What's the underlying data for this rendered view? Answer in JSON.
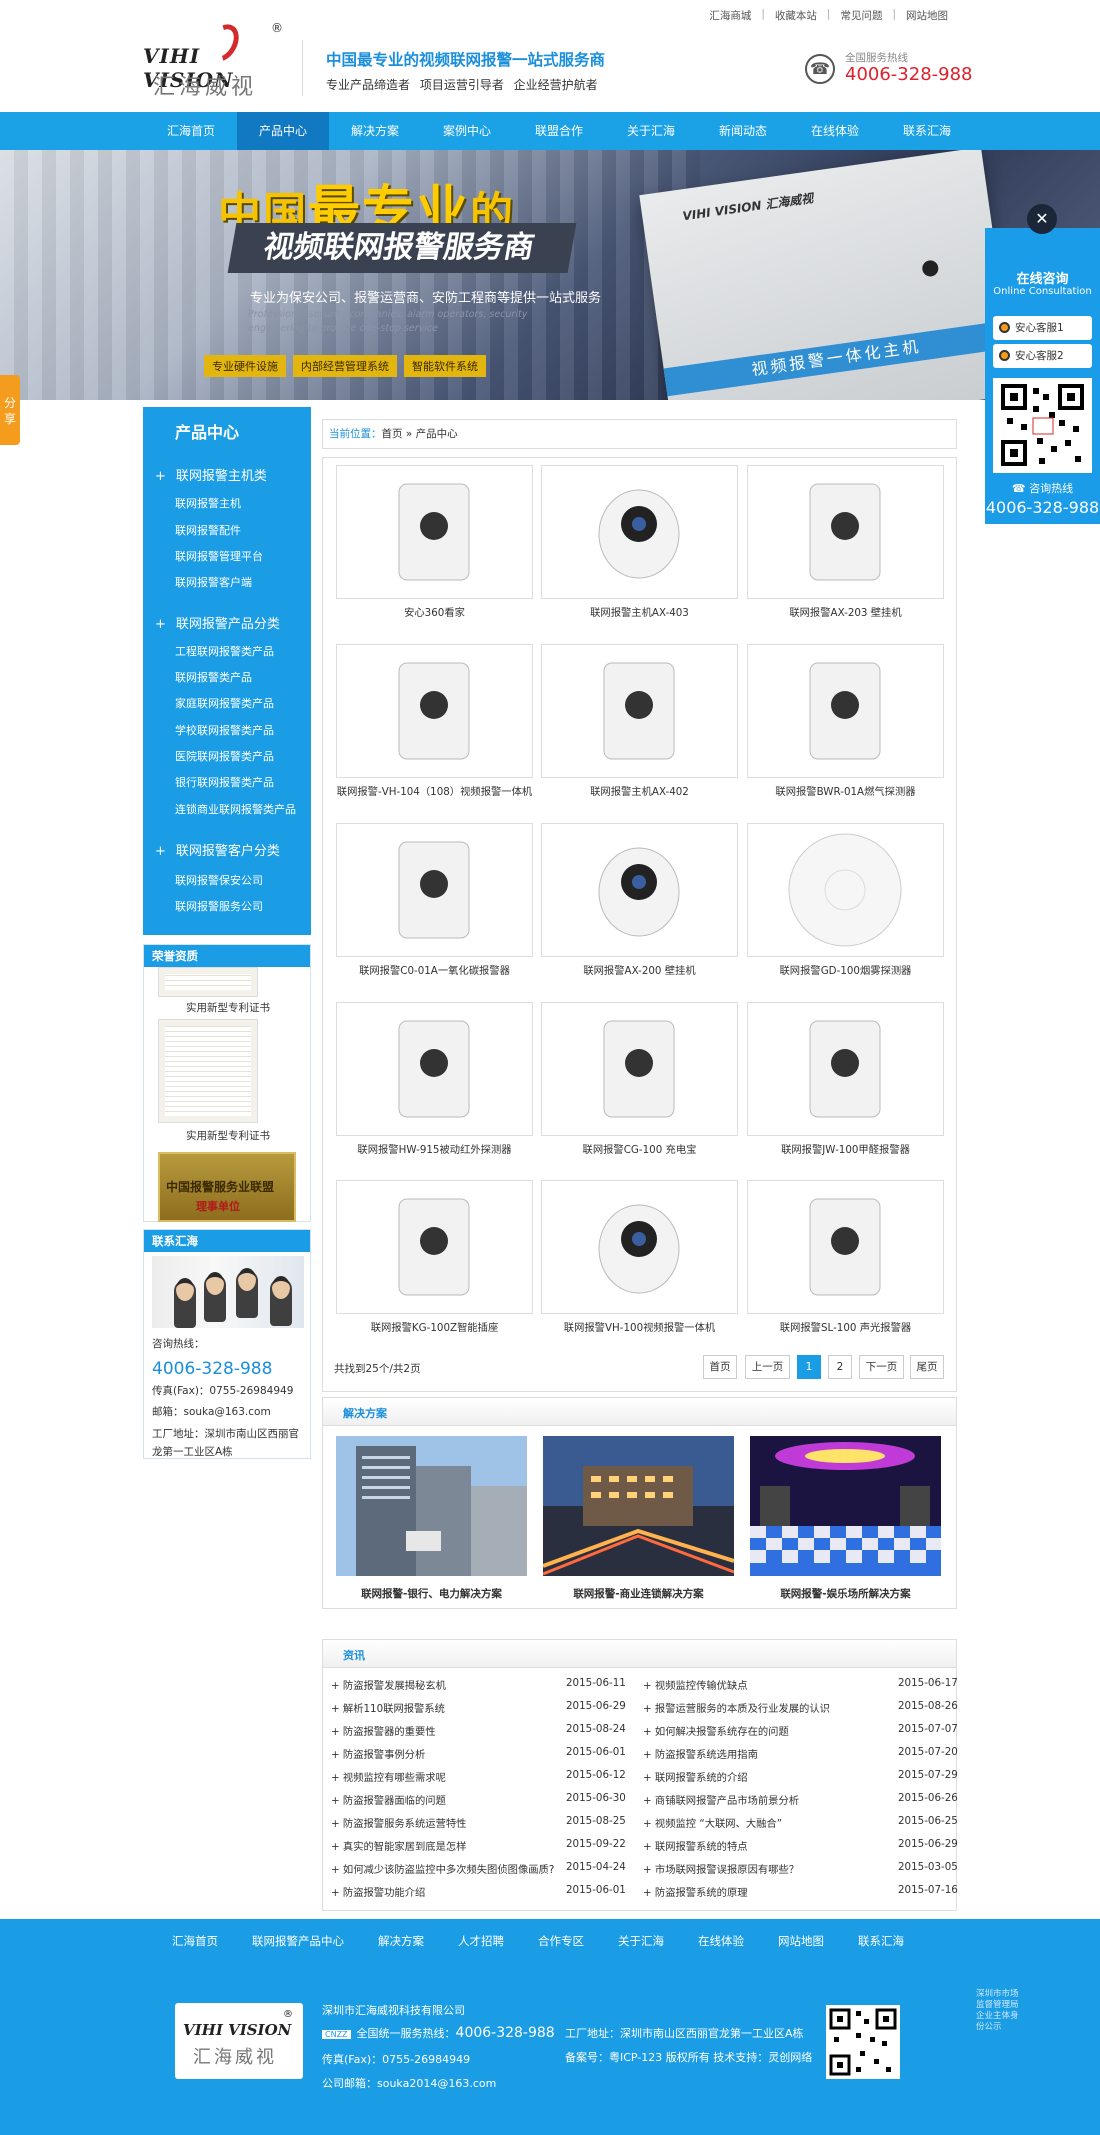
{
  "top_links": [
    "汇海商城",
    "收藏本站",
    "常见问题",
    "网站地图"
  ],
  "logo": {
    "en": "VIHI VISION",
    "cn": "汇海威视",
    "reg": "®"
  },
  "header": {
    "slogan": "中国最专业的视频联网报警一站式服务商",
    "subslogan": "专业产品缔造者 项目运营引导者 企业经营护航者",
    "hotline_label": "全国服务热线",
    "hotline": "4006-328-988"
  },
  "nav": [
    "汇海首页",
    "产品中心",
    "解决方案",
    "案例中心",
    "联盟合作",
    "关于汇海",
    "新闻动态",
    "在线体验",
    "联系汇海"
  ],
  "nav_active": 1,
  "banner": {
    "title1_a": "中国",
    "title1_b": "最专业",
    "title1_c": "的",
    "title2": "视频联网报警服务商",
    "desc": "专业为保安公司、报警运营商、安防工程商等提供一站式服务",
    "desc_en": "Professional security companies, alarm operators, security engineering to provide one-stop service",
    "tags": [
      "专业硬件设施",
      "内部经营管理系统",
      "智能软件系统"
    ],
    "box_brand": "VIHI VISION 汇海威视",
    "box_strip": "视频报警一体化主机"
  },
  "online": {
    "close": "✕",
    "title": "在线咨询",
    "subtitle": "Online Consultation",
    "services": [
      "安心客服1",
      "安心客服2"
    ],
    "call_label": "咨询热线",
    "tel": "4006-328-988"
  },
  "share": "分享",
  "sidebar": {
    "title": "产品中心",
    "groups": [
      {
        "name": "联网报警主机类",
        "items": [
          "联网报警主机",
          "联网报警配件",
          "联网报警管理平台",
          "联网报警客户端"
        ]
      },
      {
        "name": "联网报警产品分类",
        "items": [
          "工程联网报警类产品",
          "联网报警类产品",
          "家庭联网报警类产品",
          "学校联网报警类产品",
          "医院联网报警类产品",
          "银行联网报警类产品",
          "连锁商业联网报警类产品"
        ]
      },
      {
        "name": "联网报警客户分类",
        "items": [
          "联网报警保安公司",
          "联网报警服务公司"
        ]
      }
    ],
    "honor_title": "荣誉资质",
    "honor_captions": [
      "实用新型专利证书",
      "实用新型专利证书"
    ],
    "plaque": {
      "line1": "中国报警服务业联盟",
      "line2": "理事单位"
    },
    "contact_title": "联系汇海",
    "contact": {
      "hotline_label": "咨询热线：",
      "hotline": "4006-328-988",
      "fax": "传真(Fax)：0755-26984949",
      "email": "邮箱：souka@163.com",
      "address": "工厂地址：深圳市南山区西丽官龙第一工业区A栋"
    }
  },
  "breadcrumb": {
    "label": "当前位置：",
    "path": "首页 » 产品中心"
  },
  "products": [
    "安心360看家",
    "联网报警主机AX-403",
    "联网报警AX-203 壁挂机",
    "联网报警-VH-104（108）视频报警一体机",
    "联网报警主机AX-402",
    "联网报警BWR-01A燃气探测器",
    "联网报警C0-01A一氧化碳报警器",
    "联网报警AX-200 壁挂机",
    "联网报警GD-100烟雾探测器",
    "联网报警HW-915被动红外探测器",
    "联网报警CG-100 充电宝",
    "联网报警JW-100甲醛报警器",
    "联网报警KG-100Z智能插座",
    "联网报警VH-100视频报警一体机",
    "联网报警SL-100 声光报警器"
  ],
  "pagination": {
    "total": "共找到25个/共2页",
    "first": "首页",
    "prev": "上一页",
    "pages": [
      "1",
      "2"
    ],
    "current": "1",
    "next": "下一页",
    "last": "尾页"
  },
  "solutions": {
    "title": "解决方案",
    "items": [
      "联网报警-银行、电力解决方案",
      "联网报警-商业连锁解决方案",
      "联网报警-娱乐场所解决方案"
    ]
  },
  "news": {
    "title": "资讯",
    "left": [
      {
        "t": "防盗报警发展揭秘玄机",
        "d": "2015-06-11"
      },
      {
        "t": "解析110联网报警系统",
        "d": "2015-06-29"
      },
      {
        "t": "防盗报警器的重要性",
        "d": "2015-08-24"
      },
      {
        "t": "防盗报警事例分析",
        "d": "2015-06-01"
      },
      {
        "t": "视频监控有哪些需求呢",
        "d": "2015-06-12"
      },
      {
        "t": "防盗报警器面临的问题",
        "d": "2015-06-30"
      },
      {
        "t": "防盗报警服务系统运营特性",
        "d": "2015-08-25"
      },
      {
        "t": "真实的智能家居到底是怎样",
        "d": "2015-09-22"
      },
      {
        "t": "如何减少该防盗监控中多次频失图侦图像画质?",
        "d": "2015-04-24"
      },
      {
        "t": "防盗报警功能介绍",
        "d": "2015-06-01"
      }
    ],
    "right": [
      {
        "t": "视频监控传输优缺点",
        "d": "2015-06-17"
      },
      {
        "t": "报警运营服务的本质及行业发展的认识",
        "d": "2015-08-26"
      },
      {
        "t": "如何解决报警系统存在的问题",
        "d": "2015-07-07"
      },
      {
        "t": "防盗报警系统选用指南",
        "d": "2015-07-20"
      },
      {
        "t": "联网报警系统的介绍",
        "d": "2015-07-29"
      },
      {
        "t": "商铺联网报警产品市场前景分析",
        "d": "2015-06-26"
      },
      {
        "t": "视频监控 “大联网、大融合”",
        "d": "2015-06-25"
      },
      {
        "t": "联网报警系统的特点",
        "d": "2015-06-29"
      },
      {
        "t": "市场联网报警误报原因有哪些？",
        "d": "2015-03-05"
      },
      {
        "t": "防盗报警系统的原理",
        "d": "2015-07-16"
      }
    ]
  },
  "footer": {
    "nav": [
      "汇海首页",
      "联网报警产品中心",
      "解决方案",
      "人才招聘",
      "合作专区",
      "关于汇海",
      "在线体验",
      "网站地图",
      "联系汇海"
    ],
    "company": "深圳市汇海威视科技有限公司",
    "hotline_label": "全国统一服务热线：",
    "hotline": "4006-328-988",
    "fax": "传真(Fax)：0755-26984949",
    "email": "公司邮箱：souka2014@163.com",
    "address": "工厂地址：深圳市南山区西丽官龙第一工业区A栋",
    "icp": "备案号：粤ICP-123 版权所有  技术支持：灵创网络",
    "badge": "深圳市市场监督管理局企业主体身份公示"
  }
}
